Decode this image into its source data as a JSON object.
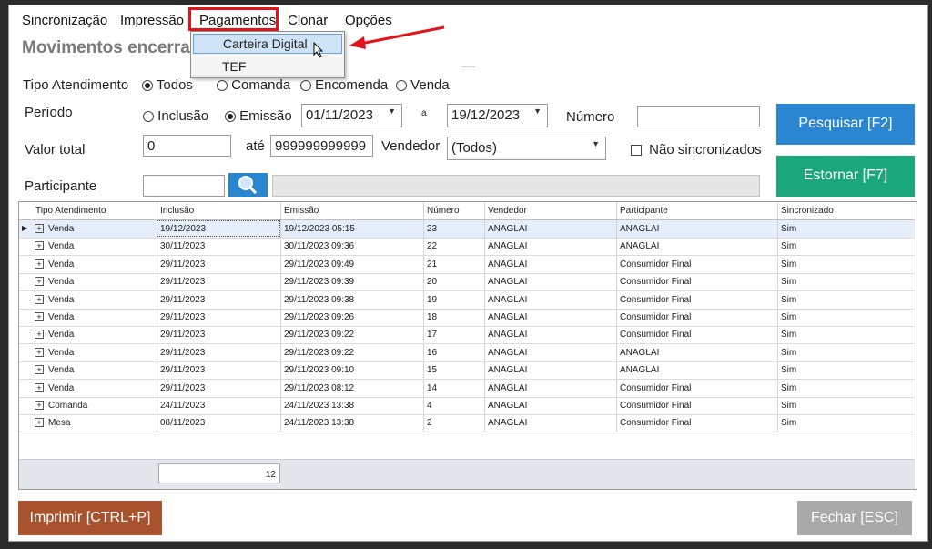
{
  "menu": [
    "Sincronização",
    "Impressão",
    "Pagamentos",
    "Clonar",
    "Opções"
  ],
  "dropdown": [
    "Carteira Digital",
    "TEF"
  ],
  "title": "Movimentos encerra",
  "title_fragment": "......",
  "tipo": {
    "label": "Tipo Atendimento",
    "options": [
      "Todos",
      "Comanda",
      "Encomenda",
      "Venda"
    ],
    "selected": "Todos"
  },
  "periodo": {
    "label": "Período",
    "inclusao": "Inclusão",
    "emissao": "Emissão",
    "from": "01/11/2023",
    "a": "a",
    "to": "19/12/2023",
    "numero_label": "Número",
    "numero_value": ""
  },
  "valor": {
    "label": "Valor total",
    "from": "0",
    "ate": "até",
    "to": "999999999999",
    "vendedor_label": "Vendedor",
    "vendedor_value": "(Todos)",
    "nao_sinc": "Não sincronizados"
  },
  "participante": {
    "label": "Participante",
    "value": ""
  },
  "buttons": {
    "pesquisar": "Pesquisar [F2]",
    "estornar": "Estornar [F7]",
    "imprimir": "Imprimir [CTRL+P]",
    "fechar": "Fechar [ESC]"
  },
  "colors": {
    "pesquisar": "#2a86d0",
    "estornar": "#1aa87a",
    "imprimir": "#a9532e",
    "fechar": "#a9a9a9",
    "highlight": "#e0141b"
  },
  "grid": {
    "headers": [
      "Tipo Atendimento",
      "Inclusão",
      "Emissão",
      "Número",
      "Vendedor",
      "Participante",
      "Sincronizado"
    ],
    "rows": [
      [
        "Venda",
        "19/12/2023",
        "19/12/2023 05:15",
        "23",
        "ANAGLAI",
        "ANAGLAI",
        "Sim"
      ],
      [
        "Venda",
        "30/11/2023",
        "30/11/2023 09:36",
        "22",
        "ANAGLAI",
        "ANAGLAI",
        "Sim"
      ],
      [
        "Venda",
        "29/11/2023",
        "29/11/2023 09:49",
        "21",
        "ANAGLAI",
        "Consumidor Final",
        "Sim"
      ],
      [
        "Venda",
        "29/11/2023",
        "29/11/2023 09:39",
        "20",
        "ANAGLAI",
        "Consumidor Final",
        "Sim"
      ],
      [
        "Venda",
        "29/11/2023",
        "29/11/2023 09:38",
        "19",
        "ANAGLAI",
        "Consumidor Final",
        "Sim"
      ],
      [
        "Venda",
        "29/11/2023",
        "29/11/2023 09:26",
        "18",
        "ANAGLAI",
        "Consumidor Final",
        "Sim"
      ],
      [
        "Venda",
        "29/11/2023",
        "29/11/2023 09:22",
        "17",
        "ANAGLAI",
        "Consumidor Final",
        "Sim"
      ],
      [
        "Venda",
        "29/11/2023",
        "29/11/2023 09:22",
        "16",
        "ANAGLAI",
        "ANAGLAI",
        "Sim"
      ],
      [
        "Venda",
        "29/11/2023",
        "29/11/2023 09:10",
        "15",
        "ANAGLAI",
        "ANAGLAI",
        "Sim"
      ],
      [
        "Venda",
        "29/11/2023",
        "29/11/2023 08:12",
        "14",
        "ANAGLAI",
        "Consumidor Final",
        "Sim"
      ],
      [
        "Comanda",
        "24/11/2023",
        "24/11/2023 13:38",
        "4",
        "ANAGLAI",
        "Consumidor Final",
        "Sim"
      ],
      [
        "Mesa",
        "08/11/2023",
        "24/11/2023 13:38",
        "2",
        "ANAGLAI",
        "Consumidor Final",
        "Sim"
      ]
    ],
    "count": "12"
  }
}
